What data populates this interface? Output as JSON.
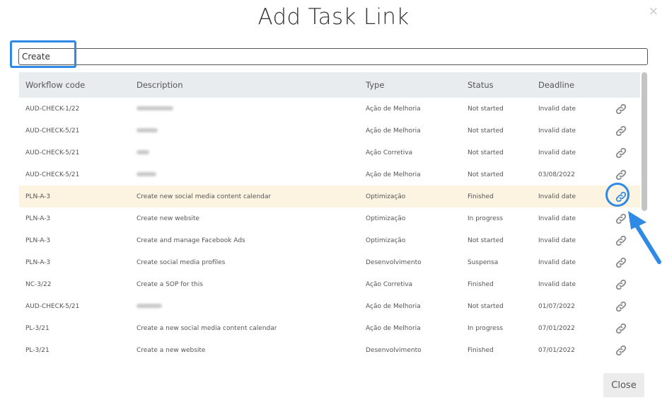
{
  "modal": {
    "title": "Add Task Link",
    "close_glyph": "×",
    "close_button_label": "Close"
  },
  "search": {
    "value": "Create",
    "placeholder": ""
  },
  "table": {
    "columns": [
      "Workflow code",
      "Description",
      "Type",
      "Status",
      "Deadline",
      ""
    ],
    "rows": [
      {
        "code": "AUD-CHECK-1/22",
        "description": "",
        "description_redacted": true,
        "type": "Ação de Melhoria",
        "status": "Not started",
        "deadline": "Invalid date"
      },
      {
        "code": "AUD-CHECK-5/21",
        "description": "",
        "description_redacted": true,
        "type": "Ação de Melhoria",
        "status": "Not started",
        "deadline": "Invalid date"
      },
      {
        "code": "AUD-CHECK-5/21",
        "description": "",
        "description_redacted": true,
        "type": "Ação Corretiva",
        "status": "Not started",
        "deadline": "Invalid date"
      },
      {
        "code": "AUD-CHECK-5/21",
        "description": "",
        "description_redacted": true,
        "type": "Ação de Melhoria",
        "status": "Not started",
        "deadline": "03/08/2022"
      },
      {
        "code": "PLN-A-3",
        "description": "Create new social media content calendar",
        "description_redacted": false,
        "type": "Optimização",
        "status": "Finished",
        "deadline": "Invalid date",
        "highlighted": true
      },
      {
        "code": "PLN-A-3",
        "description": "Create new website",
        "description_redacted": false,
        "type": "Optimização",
        "status": "In progress",
        "deadline": "Invalid date"
      },
      {
        "code": "PLN-A-3",
        "description": "Create and manage Facebook Ads",
        "description_redacted": false,
        "type": "Optimização",
        "status": "Not started",
        "deadline": "Invalid date"
      },
      {
        "code": "PLN-A-3",
        "description": "Create social media profiles",
        "description_redacted": false,
        "type": "Desenvolvimento",
        "status": "Suspensa",
        "deadline": "Invalid date"
      },
      {
        "code": "NC-3/22",
        "description": "Create a SOP for this",
        "description_redacted": false,
        "type": "Ação Corretiva",
        "status": "Finished",
        "deadline": "Invalid date"
      },
      {
        "code": "AUD-CHECK-5/21",
        "description": "",
        "description_redacted": true,
        "type": "Ação de Melhoria",
        "status": "Not started",
        "deadline": "01/07/2022"
      },
      {
        "code": "PL-3/21",
        "description": "Create a new social media content calendar",
        "description_redacted": false,
        "type": "Ação de Melhoria",
        "status": "In progress",
        "deadline": "07/01/2022"
      },
      {
        "code": "PL-3/21",
        "description": "Create a new website",
        "description_redacted": false,
        "type": "Desenvolvimento",
        "status": "Finished",
        "deadline": "07/01/2022"
      }
    ]
  },
  "icons": {
    "row_action": "link-icon",
    "dismiss": "close-icon",
    "annotation": "arrow-icon"
  },
  "colors": {
    "annotation_blue": "#2f8ae5",
    "row_highlight": "#fdf3e1",
    "header_bg": "#e9ecef",
    "link_icon_gray": "#8a8a8a"
  }
}
